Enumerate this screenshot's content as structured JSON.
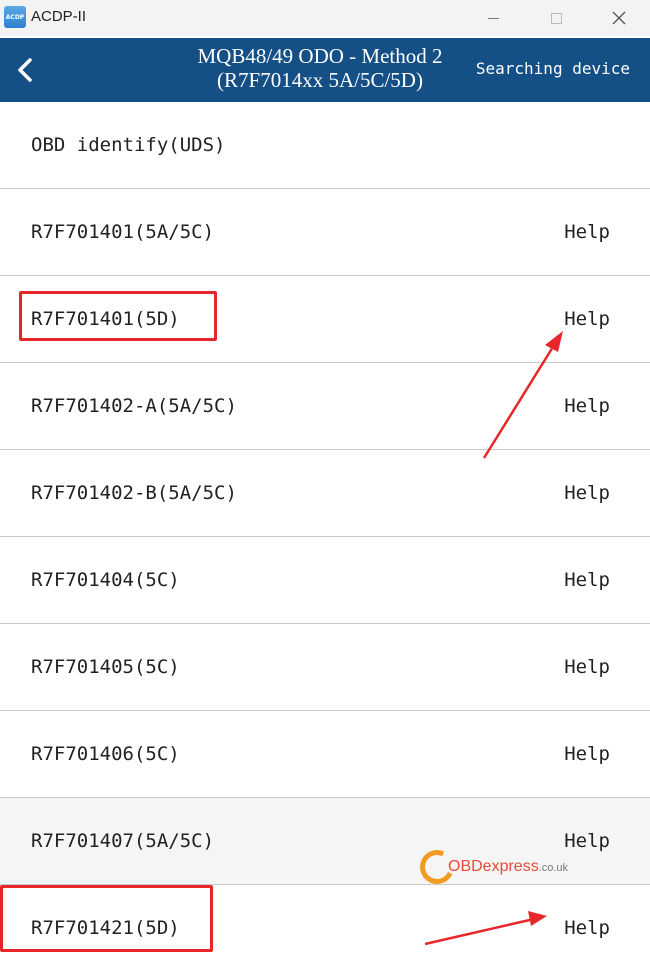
{
  "window": {
    "app_name": "ACDP-II",
    "logo_text": "ACDP"
  },
  "header": {
    "title_line1": "MQB48/49 ODO - Method 2",
    "title_line2": "(R7F7014xx 5A/5C/5D)",
    "status": "Searching device"
  },
  "list": [
    {
      "label": "OBD identify(UDS)",
      "help": ""
    },
    {
      "label": "R7F701401(5A/5C)",
      "help": "Help"
    },
    {
      "label": "R7F701401(5D)",
      "help": "Help"
    },
    {
      "label": "R7F701402-A(5A/5C)",
      "help": "Help"
    },
    {
      "label": "R7F701402-B(5A/5C)",
      "help": "Help"
    },
    {
      "label": "R7F701404(5C)",
      "help": "Help"
    },
    {
      "label": "R7F701405(5C)",
      "help": "Help"
    },
    {
      "label": "R7F701406(5C)",
      "help": "Help"
    },
    {
      "label": "R7F701407(5A/5C)",
      "help": "Help"
    },
    {
      "label": "R7F701421(5D)",
      "help": "Help"
    }
  ],
  "watermark": {
    "brand": "OBDexpress",
    "suffix": ".co.uk"
  },
  "colors": {
    "header_bg": "#144f85",
    "highlight": "#e8272a",
    "watermark_orange": "#f29a21"
  }
}
